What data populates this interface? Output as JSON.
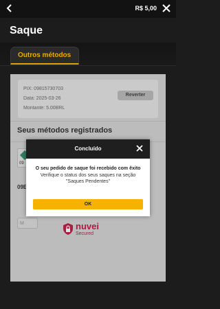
{
  "header": {
    "balance": "R$ 5,00",
    "page_title": "Saque",
    "tab_label": "Outros métodos"
  },
  "transaction": {
    "pix": "PIX: 09815730703",
    "date": "Data: 2025-03-26",
    "amount": "Montante: 5.00BRL",
    "revert_label": "Reverter"
  },
  "methods": {
    "title": "Seus métodos registrados",
    "card_label": "09",
    "account_partial": "09E",
    "input_partial": "M"
  },
  "brand": {
    "name": "nuvei",
    "sub": "Secured",
    "color": "#c0234d"
  },
  "modal": {
    "title": "Concluído",
    "message_bold": "O seu pedido de saque foi recebido com êxito",
    "message": "Verifique o status dos seus saques na seção \"Saques Pendentes\"",
    "ok_label": "OK"
  },
  "colors": {
    "accent": "#f5b300",
    "tab_text": "#f0a900",
    "background": "#1c1c1c"
  }
}
